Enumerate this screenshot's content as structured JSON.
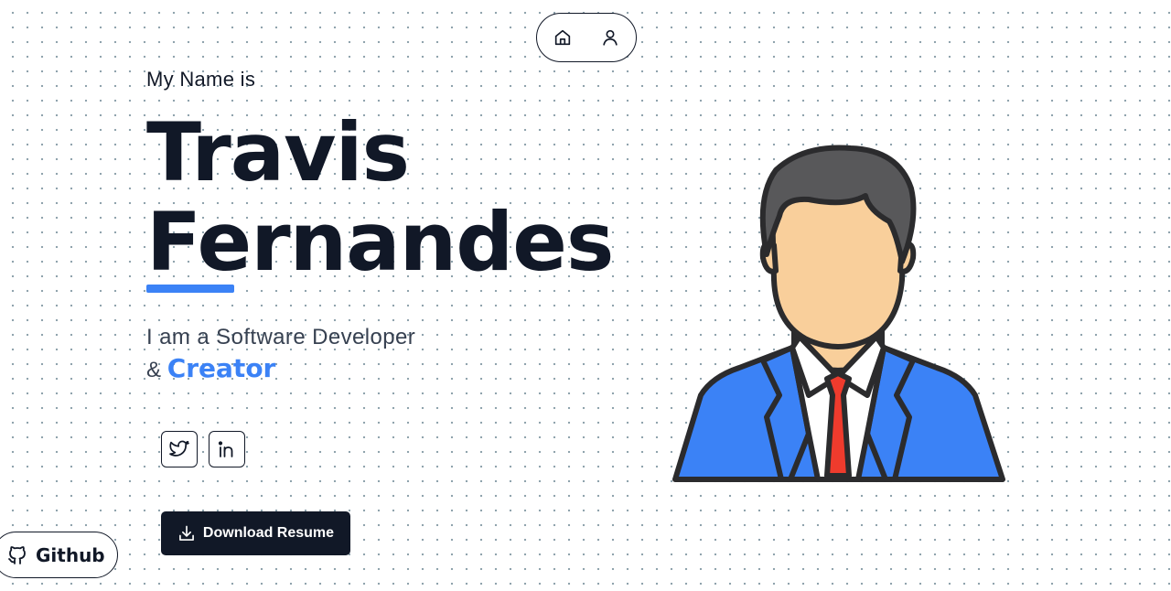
{
  "nav": {
    "items": [
      {
        "icon": "home-icon"
      },
      {
        "icon": "user-icon"
      }
    ]
  },
  "hero": {
    "intro": "My Name is",
    "first_name": "Travis",
    "last_name": "Fernandes",
    "role_line": "I am a Software Developer",
    "role_prefix": "&",
    "role_accent": "Creator"
  },
  "social": [
    {
      "icon": "twitter-icon"
    },
    {
      "icon": "linkedin-icon"
    }
  ],
  "download": {
    "label": "Download Resume",
    "icon": "download-icon"
  },
  "github": {
    "label": "Github",
    "icon": "github-icon"
  },
  "colors": {
    "accent": "#3b82f6",
    "dark": "#111827",
    "text_muted": "#374151",
    "tie": "#ef3b2d",
    "suit": "#3b82f6",
    "skin": "#f9cf9b",
    "hair": "#58585a"
  }
}
